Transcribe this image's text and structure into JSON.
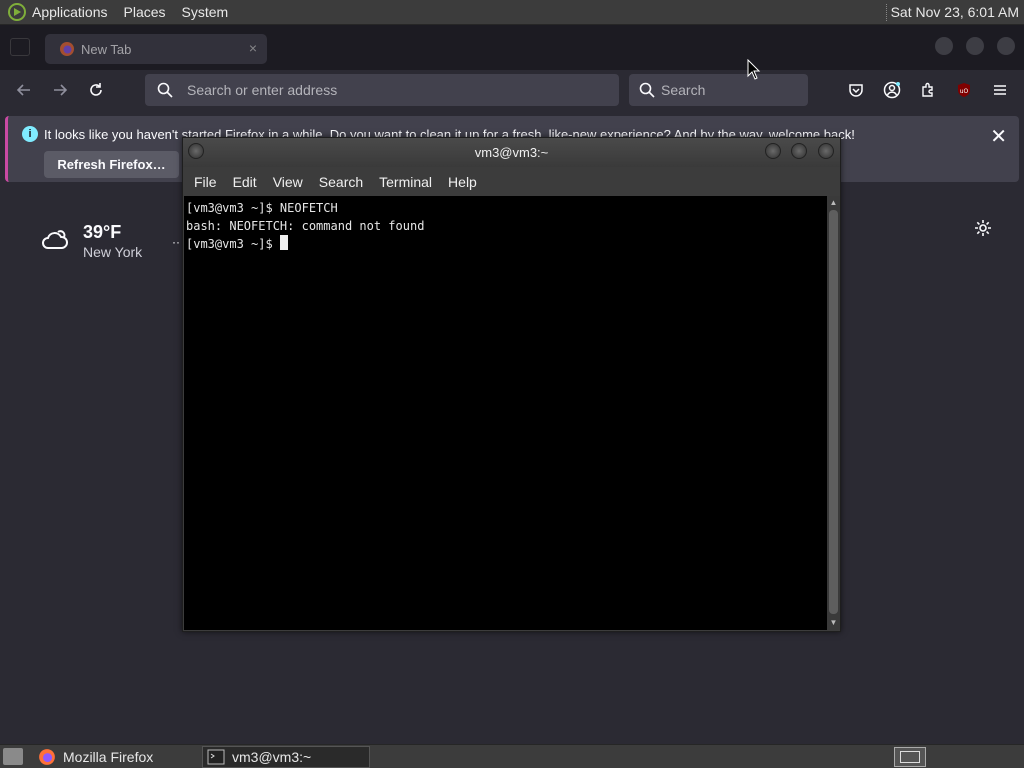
{
  "top_panel": {
    "menus": [
      "Applications",
      "Places",
      "System"
    ],
    "clock": "Sat Nov 23,  6:01 AM"
  },
  "browser": {
    "tab": {
      "title": "New Tab",
      "close": "×"
    },
    "urlbar": {
      "placeholder": "Search or enter address"
    },
    "searchbar": {
      "placeholder": "Search"
    },
    "notification": {
      "message": "It looks like you haven't started Firefox in a while. Do you want to clean it up for a fresh, like-new experience? And by the way, welcome back!",
      "button": "Refresh Firefox…"
    },
    "weather": {
      "temperature": "39°F",
      "location": "New York"
    },
    "more": "··"
  },
  "terminal": {
    "title": "vm3@vm3:~",
    "menu": [
      "File",
      "Edit",
      "View",
      "Search",
      "Terminal",
      "Help"
    ],
    "lines": [
      "[vm3@vm3 ~]$ NEOFETCH",
      "bash: NEOFETCH: command not found",
      "[vm3@vm3 ~]$ "
    ]
  },
  "taskbar": {
    "items": [
      "Mozilla Firefox",
      "vm3@vm3:~"
    ]
  },
  "colors": {
    "panel": "#3c3c3c",
    "firefox_bg": "#2b2a33",
    "notification_accent": "#c94aa3",
    "terminal_bg": "#000000"
  }
}
